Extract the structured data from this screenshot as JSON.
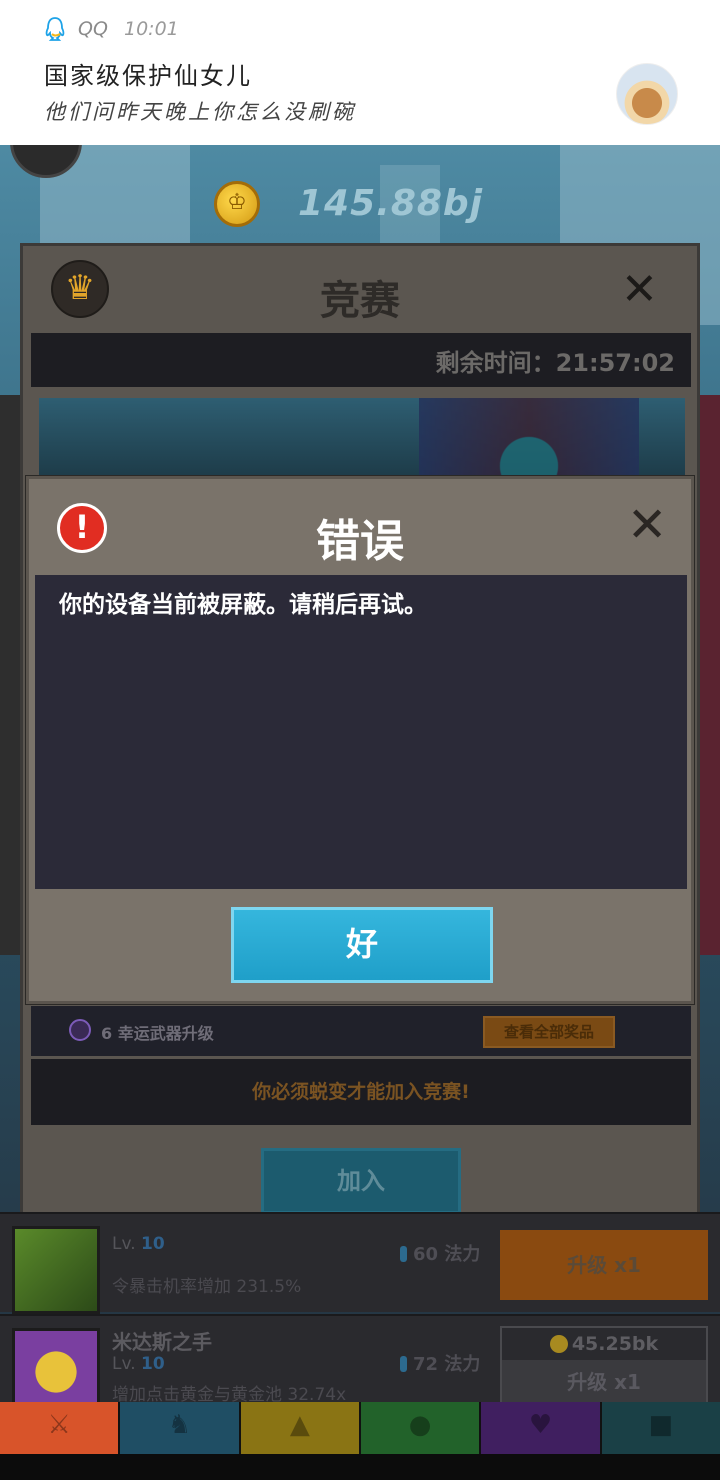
{
  "notification": {
    "app_name": "QQ",
    "time": "10:01",
    "title": "国家级保护仙女儿",
    "body": "他们问昨天晚上你怎么没刷碗",
    "icon": "qq-icon",
    "avatar": "contact-avatar"
  },
  "hud": {
    "gold_amount": "145.88bj"
  },
  "competition_dialog": {
    "title": "竞赛",
    "timer": "剩余时间：21:57:02",
    "rewards_text": "6 幸运武器升级",
    "view_all_label": "查看全部奖品",
    "notice": "你必须蜕变才能加入竞赛!",
    "join_label": "加入"
  },
  "error_dialog": {
    "title": "错误",
    "message": "你的设备当前被屏蔽。请稍后再试。",
    "ok_label": "好",
    "accent_color": "#e12d22"
  },
  "upgrade_rows": [
    {
      "name": "",
      "level_prefix": "Lv.",
      "level": "10",
      "mana": "60 法力",
      "description": "令暴击机率增加 231.5%",
      "upgrade_label": "升级 x1",
      "cost": ""
    },
    {
      "name": "米达斯之手",
      "level_prefix": "Lv.",
      "level": "10",
      "mana": "72 法力",
      "description": "增加点击黄金与黄金池 32.74x",
      "upgrade_label": "升级 x1",
      "cost": "45.25bk"
    }
  ],
  "bottom_tabs": [
    {
      "icon": "sword-icon",
      "color": "#d8542a"
    },
    {
      "icon": "knight-helmet-icon",
      "color": "#2c6c8a"
    },
    {
      "icon": "armor-shirt-icon",
      "color": "#c3a21a"
    },
    {
      "icon": "pet-icon",
      "color": "#2f8a3a"
    },
    {
      "icon": "heart-crest-icon",
      "color": "#5a2c86"
    },
    {
      "icon": "chest-icon",
      "color": "#245860"
    }
  ]
}
